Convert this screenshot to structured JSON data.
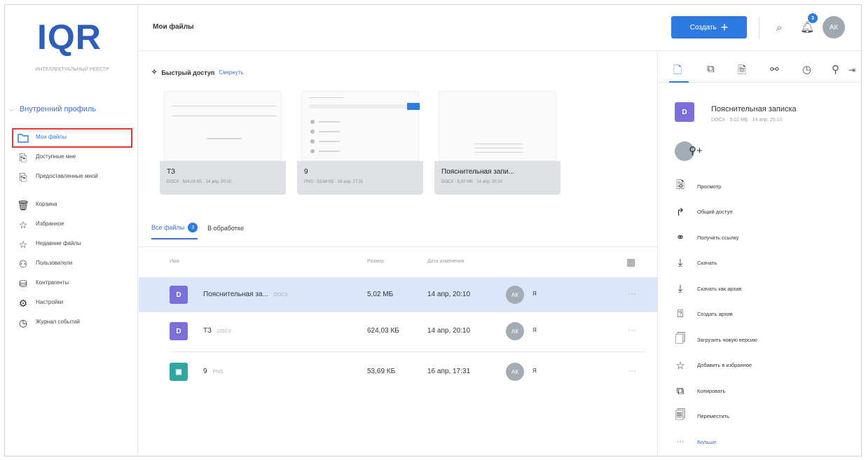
{
  "sidebar": {
    "logo_main": "IQR",
    "logo_sub": "ИНТЕЛЛЕКТУАЛЬНЫЙ РЕЕСТР",
    "profile": "Внутренний профиль",
    "items": [
      {
        "label": "Мои файлы",
        "icon": "folder-icon"
      },
      {
        "label": "Доступные мне",
        "icon": "shared-doc-icon"
      },
      {
        "label": "Предоставленные мной",
        "icon": "shared-out-icon"
      },
      {
        "label": "Корзина",
        "icon": "trash-icon"
      },
      {
        "label": "Избранное",
        "icon": "star-icon"
      },
      {
        "label": "Недавние файлы",
        "icon": "recent-icon"
      },
      {
        "label": "Пользователи",
        "icon": "users-icon"
      },
      {
        "label": "Контрагенты",
        "icon": "partners-icon"
      },
      {
        "label": "Настройки",
        "icon": "gear-icon"
      },
      {
        "label": "Журнал событий",
        "icon": "clock-icon"
      }
    ]
  },
  "header": {
    "title": "Мои файлы",
    "create_label": "Создать",
    "avatar_initials": "АК",
    "notifications": "3"
  },
  "quick_access": {
    "title": "Быстрый доступ",
    "collapse_label": "Свернуть",
    "cards": [
      {
        "name": "ТЗ",
        "meta": "DOCX · 624,03 КБ · 14 апр, 20:10"
      },
      {
        "name": "9",
        "meta": "PNG · 53,69 КБ · 16 апр, 17:31"
      },
      {
        "name": "Пояснительная запи...",
        "meta": "DOCX · 5,02 МБ · 14 апр, 20:10"
      }
    ]
  },
  "tabs": {
    "all_label": "Все файлы",
    "all_count": "3",
    "processing_label": "В обработке"
  },
  "table": {
    "col_name": "Имя",
    "col_size": "Размер",
    "col_date": "Дата изменения",
    "rows": [
      {
        "name": "Пояснительная за...",
        "ext": "DOCX",
        "size": "5,02 МБ",
        "date": "14 апр, 20:10",
        "initials": "АК",
        "owner": "Я",
        "color": "#7b6fd9",
        "selected": true
      },
      {
        "name": "ТЗ",
        "ext": "DOCX",
        "size": "624,03 КБ",
        "date": "14 апр, 20:10",
        "initials": "АК",
        "owner": "Я",
        "color": "#7b6fd9",
        "selected": false
      },
      {
        "name": "9",
        "ext": "PNG",
        "size": "53,69 КБ",
        "date": "16 апр, 17:31",
        "initials": "АК",
        "owner": "Я",
        "color": "#2fa6a0",
        "selected": false
      }
    ]
  },
  "details": {
    "file_name": "Пояснительная записка",
    "file_meta": "DOCX · 5,02 МБ · 14 апр, 20:10",
    "actions": [
      {
        "label": "Просмотр",
        "icon": "preview-icon"
      },
      {
        "label": "Общий доступ",
        "icon": "share-icon"
      },
      {
        "label": "Получить ссылку",
        "icon": "link-icon"
      },
      {
        "label": "Скачать",
        "icon": "download-icon"
      },
      {
        "label": "Скачать как архив",
        "icon": "download-archive-icon"
      },
      {
        "label": "Создать архив",
        "icon": "archive-icon"
      },
      {
        "label": "Загрузить новую версию",
        "icon": "upload-version-icon"
      },
      {
        "label": "Добавить в избранное",
        "icon": "star-icon"
      },
      {
        "label": "Копировать",
        "icon": "copy-icon"
      },
      {
        "label": "Переместить",
        "icon": "move-icon"
      },
      {
        "label": "Больше",
        "icon": "more-icon"
      }
    ]
  }
}
